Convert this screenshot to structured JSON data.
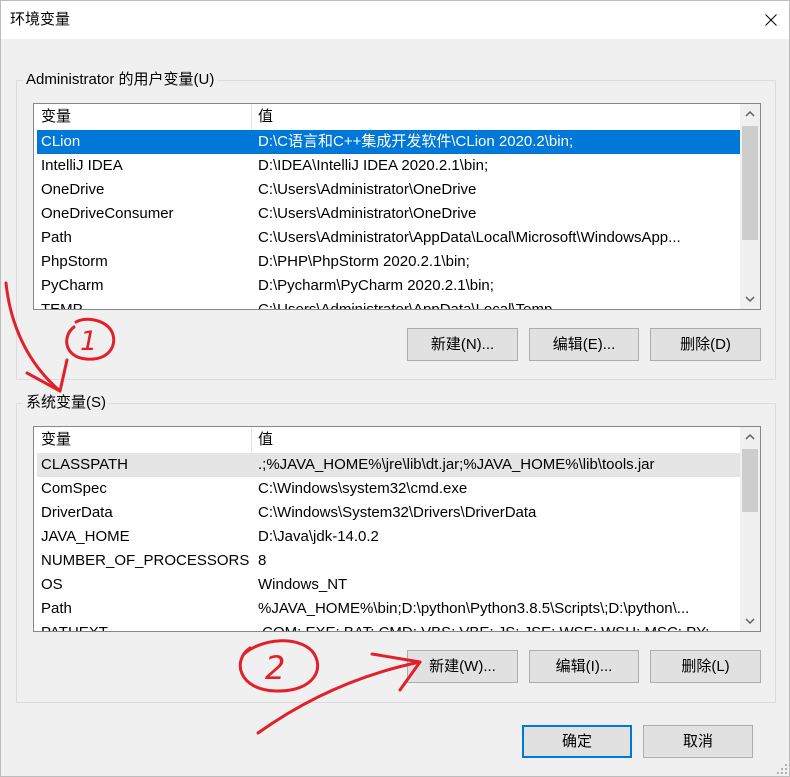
{
  "window": {
    "title": "环境变量"
  },
  "icons": {
    "close": "close-icon",
    "scroll_up": "chevron-up-icon",
    "scroll_down": "chevron-down-icon",
    "resize": "size-grip-icon"
  },
  "colors": {
    "selection": "#0078d7",
    "selection_inactive": "#e5e5e5",
    "default_button_border": "#0078d7",
    "annotation": "#e3202a"
  },
  "user_vars": {
    "label": "Administrator 的用户变量(U)",
    "columns": {
      "name": "变量",
      "value": "值"
    },
    "selected_index": 0,
    "focused": true,
    "rows": [
      {
        "name": "CLion",
        "value": "D:\\C语言和C++集成开发软件\\CLion 2020.2\\bin;"
      },
      {
        "name": "IntelliJ IDEA",
        "value": "D:\\IDEA\\IntelliJ IDEA 2020.2.1\\bin;"
      },
      {
        "name": "OneDrive",
        "value": "C:\\Users\\Administrator\\OneDrive"
      },
      {
        "name": "OneDriveConsumer",
        "value": "C:\\Users\\Administrator\\OneDrive"
      },
      {
        "name": "Path",
        "value": "C:\\Users\\Administrator\\AppData\\Local\\Microsoft\\WindowsApp..."
      },
      {
        "name": "PhpStorm",
        "value": "D:\\PHP\\PhpStorm 2020.2.1\\bin;"
      },
      {
        "name": "PyCharm",
        "value": "D:\\Pycharm\\PyCharm 2020.2.1\\bin;"
      },
      {
        "name": "TEMP",
        "value": "C:\\Users\\Administrator\\AppData\\Local\\Temp"
      }
    ],
    "buttons": {
      "new": "新建(N)...",
      "edit": "编辑(E)...",
      "delete": "删除(D)"
    }
  },
  "system_vars": {
    "label": "系统变量(S)",
    "columns": {
      "name": "变量",
      "value": "值"
    },
    "selected_index": 0,
    "focused": false,
    "rows": [
      {
        "name": "CLASSPATH",
        "value": ".;%JAVA_HOME%\\jre\\lib\\dt.jar;%JAVA_HOME%\\lib\\tools.jar"
      },
      {
        "name": "ComSpec",
        "value": "C:\\Windows\\system32\\cmd.exe"
      },
      {
        "name": "DriverData",
        "value": "C:\\Windows\\System32\\Drivers\\DriverData"
      },
      {
        "name": "JAVA_HOME",
        "value": "D:\\Java\\jdk-14.0.2"
      },
      {
        "name": "NUMBER_OF_PROCESSORS",
        "value": "8"
      },
      {
        "name": "OS",
        "value": "Windows_NT"
      },
      {
        "name": "Path",
        "value": "%JAVA_HOME%\\bin;D:\\python\\Python3.8.5\\Scripts\\;D:\\python\\..."
      },
      {
        "name": "PATHEXT",
        "value": ".COM;.EXE;.BAT;.CMD;.VBS;.VBE;.JS;.JSE;.WSF;.WSH;.MSC;.PY;.PYW"
      }
    ],
    "buttons": {
      "new": "新建(W)...",
      "edit": "编辑(I)...",
      "delete": "删除(L)"
    }
  },
  "dialog_buttons": {
    "ok": "确定",
    "cancel": "取消"
  },
  "annotations": [
    {
      "label": "1"
    },
    {
      "label": "2"
    }
  ]
}
